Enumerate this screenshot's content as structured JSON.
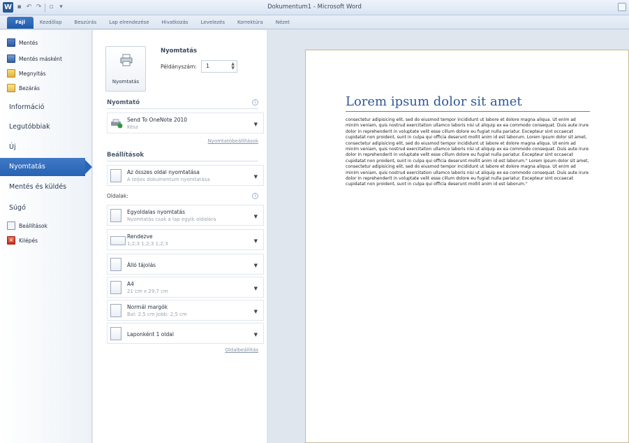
{
  "window": {
    "title": "Dokumentum1 - Microsoft Word",
    "app_icon": "W"
  },
  "ribbon_tabs": [
    "Fájl",
    "Kezdőlap",
    "Beszúrás",
    "Lap elrendezése",
    "Hivatkozás",
    "Levelezés",
    "Korrektúra",
    "Nézet"
  ],
  "nav": {
    "commands_top": [
      {
        "label": "Mentés",
        "icon": "save-icon"
      },
      {
        "label": "Mentés másként",
        "icon": "save-as-icon"
      },
      {
        "label": "Megnyitás",
        "icon": "open-folder-icon"
      },
      {
        "label": "Bezárás",
        "icon": "close-folder-icon"
      }
    ],
    "sections": [
      "Információ",
      "Legutóbbiak",
      "Új",
      "Nyomtatás",
      "Mentés és küldés",
      "Súgó"
    ],
    "active_section": "Nyomtatás",
    "commands_bottom": [
      {
        "label": "Beállítások",
        "icon": "options-icon"
      },
      {
        "label": "Kilépés",
        "icon": "exit-icon"
      }
    ]
  },
  "print": {
    "button_label": "Nyomtatás",
    "title": "Nyomtatás",
    "copies_label": "Példányszám:",
    "copies_value": "1",
    "printer_heading": "Nyomtató",
    "printer_name": "Send To OneNote 2010",
    "printer_status": "Kész",
    "printer_properties_link": "Nyomtatóbeállítások",
    "settings_heading": "Beállítások",
    "settings": [
      {
        "title": "Az összes oldal nyomtatása",
        "subtitle": "A teljes dokumentum nyomtatása"
      },
      {
        "title": "Egyoldalas nyomtatás",
        "subtitle": "Nyomtatás csak a lap egyik oldalára"
      },
      {
        "title": "Rendezve",
        "subtitle": "1;2;3   1;2;3   1;2;3"
      },
      {
        "title": "Álló tájolás",
        "subtitle": ""
      },
      {
        "title": "A4",
        "subtitle": "21 cm x 29,7 cm"
      },
      {
        "title": "Normál margók",
        "subtitle": "Bal: 2,5 cm   Jobb: 2,5 cm"
      },
      {
        "title": "Laponként 1 oldal",
        "subtitle": ""
      }
    ],
    "pages_label": "Oldalak:",
    "page_setup_link": "Oldalbeállítás"
  },
  "preview": {
    "heading": "Lorem ipsum dolor sit amet",
    "body": "consectetur adipisicing elit, sed do eiusmod tempor incididunt ut labore et dolore magna aliqua. Ut enim ad minim veniam, quis nostrud exercitation ullamco laboris nisi ut aliquip ex ea commodo consequat. Duis aute irure dolor in reprehenderit in voluptate velit esse cillum dolore eu fugiat nulla pariatur. Excepteur sint occaecat cupidatat non proident, sunt in culpa qui officia deserunt mollit anim id est laborum. Lorem ipsum dolor sit amet, consectetur adipisicing elit, sed do eiusmod tempor incididunt ut labore et dolore magna aliqua. Ut enim ad minim veniam, quis nostrud exercitation ullamco laboris nisi ut aliquip ex ea commodo consequat. Duis aute irure dolor in reprehenderit in voluptate velit esse cillum dolore eu fugiat nulla pariatur. Excepteur sint occaecat cupidatat non proident, sunt in culpa qui officia deserunt mollit anim id est laborum.\" Lorem ipsum dolor sit amet, consectetur adipisicing elit, sed do eiusmod tempor incididunt ut labore et dolore magna aliqua. Ut enim ad minim veniam, quis nostrud exercitation ullamco laboris nisi ut aliquip ex ea commodo consequat. Duis aute irure dolor in reprehenderit in voluptate velit esse cillum dolore eu fugiat nulla pariatur. Excepteur sint occaecat cupidatat non proident, sunt in culpa qui officia deserunt mollit anim id est laborum.\""
  }
}
